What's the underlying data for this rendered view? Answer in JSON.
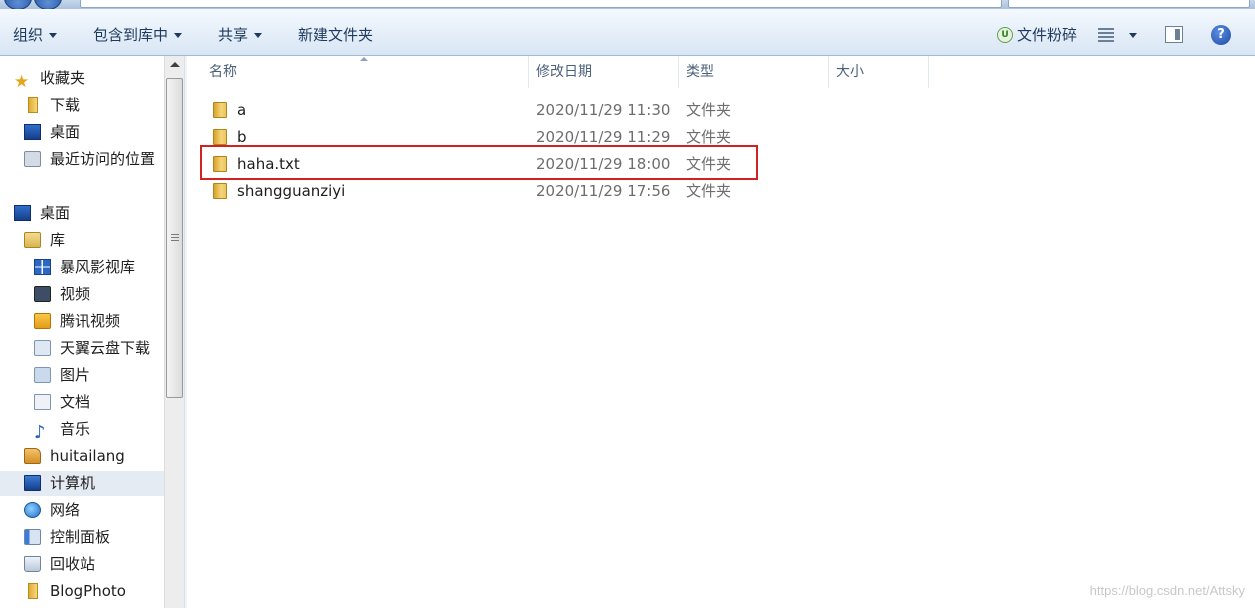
{
  "toolbar": {
    "organize": "组织",
    "include_library": "包含到库中",
    "share": "共享",
    "new_folder": "新建文件夹",
    "shred": "文件粉碎",
    "help": "?"
  },
  "nav": {
    "favorites": "收藏夹",
    "downloads": "下载",
    "desktop_fav": "桌面",
    "recent": "最近访问的位置",
    "desktop": "桌面",
    "libraries": "库",
    "baofeng": "暴风影视库",
    "videos": "视频",
    "tencent_video": "腾讯视频",
    "tianyi": "天翼云盘下载",
    "pictures": "图片",
    "documents": "文档",
    "music": "音乐",
    "user": "huitailang",
    "computer": "计算机",
    "network": "网络",
    "control_panel": "控制面板",
    "recycle_bin": "回收站",
    "blogphoto": "BlogPhoto"
  },
  "columns": {
    "name": "名称",
    "modified": "修改日期",
    "type": "类型",
    "size": "大小"
  },
  "files": [
    {
      "name": "a",
      "modified": "2020/11/29 11:30",
      "type": "文件夹"
    },
    {
      "name": "b",
      "modified": "2020/11/29 11:29",
      "type": "文件夹"
    },
    {
      "name": "haha.txt",
      "modified": "2020/11/29 18:00",
      "type": "文件夹"
    },
    {
      "name": "shangguanziyi",
      "modified": "2020/11/29 17:56",
      "type": "文件夹"
    }
  ],
  "watermark": "https://blog.csdn.net/Attsky",
  "colors": {
    "highlight_border": "#d22121",
    "toolbar_text": "#1e395b",
    "folder": "#f5d57a"
  }
}
